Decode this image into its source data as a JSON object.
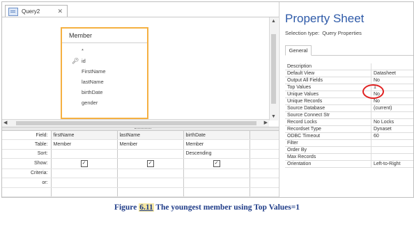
{
  "designer": {
    "tab_label": "Query2",
    "tab_close": "✕",
    "table": {
      "title": "Member",
      "fields": [
        "*",
        "id",
        "FirstName",
        "lastName",
        "birthDate",
        "gender"
      ]
    },
    "grid": {
      "row_labels": [
        "Field:",
        "Table:",
        "Sort:",
        "Show:",
        "Criteria:",
        "or:"
      ],
      "columns": [
        {
          "field": "firstName",
          "table": "Member",
          "sort": "",
          "show": true
        },
        {
          "field": "lastName",
          "table": "Member",
          "sort": "",
          "show": true
        },
        {
          "field": "birthDate",
          "table": "Member",
          "sort": "Descending",
          "show": true
        }
      ]
    }
  },
  "property_sheet": {
    "title": "Property Sheet",
    "selection_label": "Selection type:",
    "selection_value": "Query Properties",
    "tab_general": "General",
    "properties": [
      {
        "name": "Description",
        "value": ""
      },
      {
        "name": "Default View",
        "value": "Datasheet"
      },
      {
        "name": "Output All Fields",
        "value": "No"
      },
      {
        "name": "Top Values",
        "value": "1"
      },
      {
        "name": "Unique Values",
        "value": "No"
      },
      {
        "name": "Unique Records",
        "value": "No"
      },
      {
        "name": "Source Database",
        "value": "(current)"
      },
      {
        "name": "Source Connect Str",
        "value": ""
      },
      {
        "name": "Record Locks",
        "value": "No Locks"
      },
      {
        "name": "Recordset Type",
        "value": "Dynaset"
      },
      {
        "name": "ODBC Timeout",
        "value": "60"
      },
      {
        "name": "Filter",
        "value": ""
      },
      {
        "name": "Order By",
        "value": ""
      },
      {
        "name": "Max Records",
        "value": ""
      },
      {
        "name": "Orientation",
        "value": "Left-to-Right"
      }
    ]
  },
  "caption": {
    "figure_label": "Figure",
    "figure_number": "6.11",
    "text": "The youngest member using Top Values=1"
  },
  "colors": {
    "accent": "#2e5aa8",
    "table_border": "#f5b041",
    "highlight_circle": "#e02020",
    "caption": "#1f3c88"
  },
  "icons": {
    "primary_key": "key-icon",
    "query_tab": "query-icon",
    "close": "close-icon",
    "checkbox": "checkbox-checked-icon"
  }
}
